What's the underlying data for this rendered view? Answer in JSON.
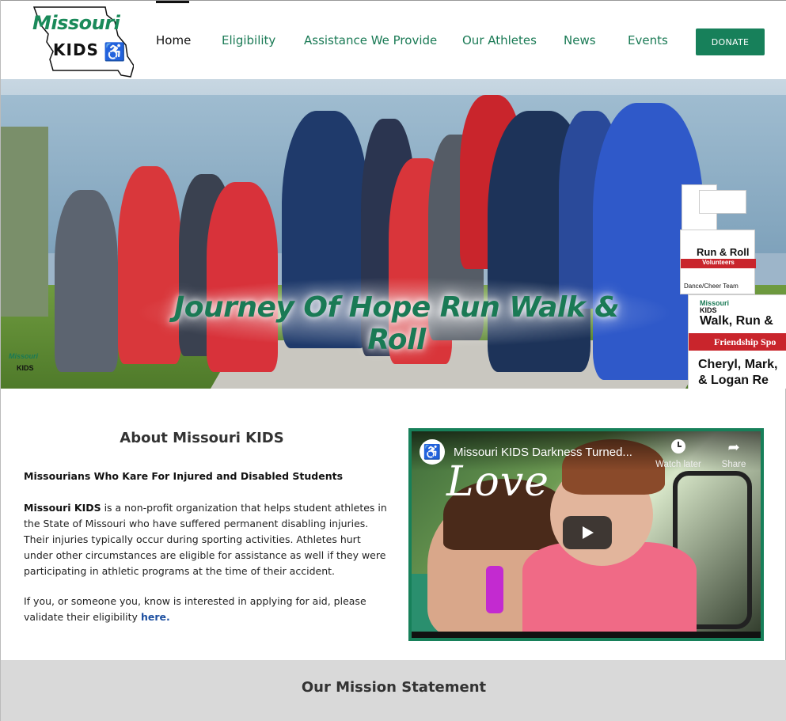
{
  "logo": {
    "line1": "Missouri",
    "line2": "KIDS",
    "icon": "wheelchair-icon"
  },
  "nav": {
    "items": [
      {
        "label": "Home"
      },
      {
        "label": "Eligibility"
      },
      {
        "label": "Assistance We Provide"
      },
      {
        "label": "Our Athletes"
      },
      {
        "label": "News"
      },
      {
        "label": "Events"
      }
    ],
    "donate_label": "DONATE"
  },
  "hero": {
    "title": "Journey Of Hope Run Walk & Roll",
    "sign": {
      "brand_line1": "Missouri",
      "brand_line2": "KIDS",
      "headline": "Walk, Run &",
      "ribbon": "Friendship Spo",
      "names_line1": "Cheryl, Mark,",
      "names_line2": "& Logan Re"
    },
    "small_sign": {
      "headline": "Run & Roll",
      "ribbon": "Volunteers",
      "caption": "Dance/Cheer Team"
    },
    "corner_logo": {
      "line1": "Missouri",
      "line2": "KIDS"
    }
  },
  "about": {
    "title": "About Missouri KIDS",
    "subtitle": "Missourians Who Kare For Injured and Disabled Students",
    "org_name": "Missouri KIDS",
    "paragraph1": " is a non-profit organization that helps student athletes in the State of Missouri who have suffered permanent disabling injuries. Their injuries typically occur during sporting activities. Athletes hurt under other circumstances are eligible for assistance as well if they were participating in athletic programs at the time of their accident.",
    "paragraph2": "If you, or someone you, know is interested in applying for aid, please validate their eligibility ",
    "link_label": "here."
  },
  "video": {
    "title": "Missouri KIDS Darkness Turned...",
    "overlay_word": "Love",
    "watch_later_label": "Watch later",
    "share_label": "Share"
  },
  "mission": {
    "title": "Our Mission Statement"
  },
  "colors": {
    "brand_green": "#17805a",
    "link_blue": "#1d4fa0",
    "mission_bg": "#d9d9d9"
  }
}
